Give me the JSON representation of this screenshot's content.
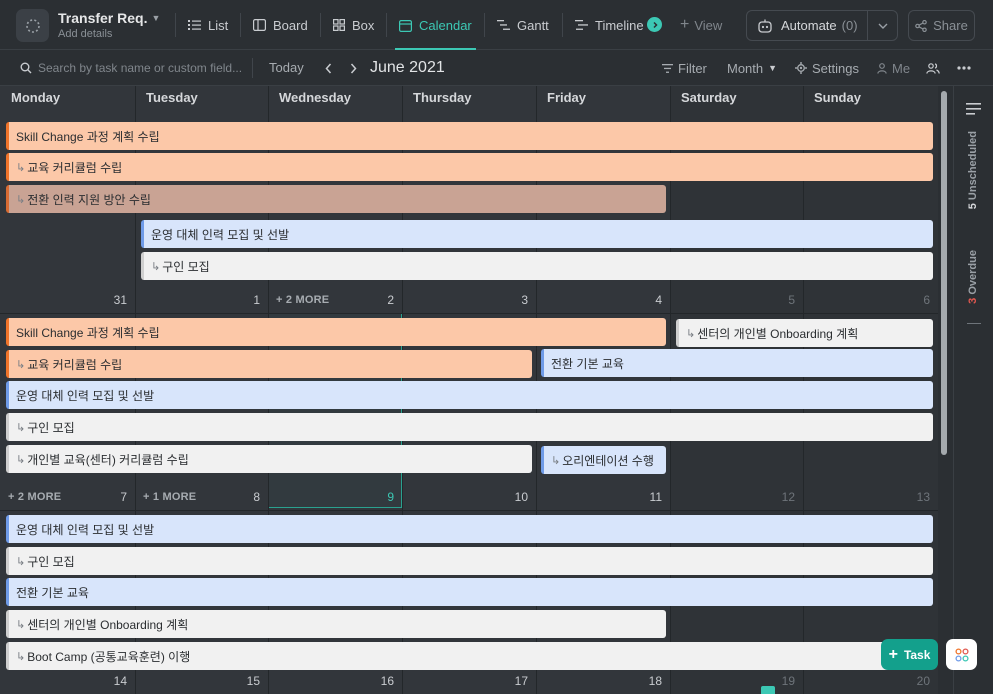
{
  "header": {
    "title": "Transfer Req.",
    "subtitle": "Add details",
    "views": [
      {
        "label": "List",
        "icon": "list-icon"
      },
      {
        "label": "Board",
        "icon": "board-icon"
      },
      {
        "label": "Box",
        "icon": "box-icon"
      },
      {
        "label": "Calendar",
        "icon": "calendar-icon",
        "active": true
      },
      {
        "label": "Gantt",
        "icon": "gantt-icon"
      },
      {
        "label": "Timeline",
        "icon": "timeline-icon"
      }
    ],
    "add_view_label": "View",
    "automate_label": "Automate",
    "automate_count": "(0)",
    "share_label": "Share"
  },
  "toolbar": {
    "search_placeholder": "Search by task name or custom field...",
    "today_label": "Today",
    "month_title": "June 2021",
    "filter_label": "Filter",
    "period_label": "Month",
    "settings_label": "Settings",
    "me_label": "Me"
  },
  "calendar": {
    "day_names": [
      "Monday",
      "Tuesday",
      "Wednesday",
      "Thursday",
      "Friday",
      "Saturday",
      "Sunday"
    ],
    "weeks": [
      {
        "days": [
          "31",
          "1",
          "2",
          "3",
          "4",
          "5",
          "6"
        ],
        "more": [
          {
            "day_index": 2,
            "label": "+ 2 MORE"
          }
        ],
        "tasks": [
          {
            "label": "Skill Change 과정 계획 수립",
            "color": "orange",
            "subtask": false
          },
          {
            "label": "교육 커리큘럼 수립",
            "color": "orange",
            "subtask": true
          },
          {
            "label": "전환 인력 지원 방안 수립",
            "color": "orange-dim",
            "subtask": true
          },
          {
            "label": "운영 대체 인력 모집 및 선발",
            "color": "blue",
            "subtask": false
          },
          {
            "label": "구인 모집",
            "color": "gray",
            "subtask": true
          }
        ]
      },
      {
        "days": [
          "7",
          "8",
          "9",
          "10",
          "11",
          "12",
          "13"
        ],
        "more": [
          {
            "day_index": 0,
            "label": "+ 2 MORE"
          },
          {
            "day_index": 1,
            "label": "+ 1 MORE"
          }
        ],
        "tasks": [
          {
            "label": "Skill Change 과정 계획 수립",
            "color": "orange",
            "subtask": false
          },
          {
            "label": "센터의 개인별 Onboarding 계획",
            "color": "gray",
            "subtask": true
          },
          {
            "label": "교육 커리큘럼 수립",
            "color": "orange",
            "subtask": true
          },
          {
            "label": "전환 기본 교육",
            "color": "blue",
            "subtask": false
          },
          {
            "label": "운영 대체 인력 모집 및 선발",
            "color": "blue",
            "subtask": false
          },
          {
            "label": "구인 모집",
            "color": "gray",
            "subtask": true
          },
          {
            "label": "개인별 교육(센터) 커리큘럼 수립",
            "color": "gray",
            "subtask": true
          },
          {
            "label": "오리엔테이션 수행",
            "color": "blue",
            "subtask": true
          }
        ]
      },
      {
        "days": [
          "14",
          "15",
          "16",
          "17",
          "18",
          "19",
          "20"
        ],
        "tasks": [
          {
            "label": "운영 대체 인력 모집 및 선발",
            "color": "blue",
            "subtask": false
          },
          {
            "label": "구인 모집",
            "color": "gray",
            "subtask": true
          },
          {
            "label": "전환 기본 교육",
            "color": "blue",
            "subtask": false
          },
          {
            "label": "센터의 개인별 Onboarding 계획",
            "color": "gray",
            "subtask": true
          },
          {
            "label": "Boot Camp (공통교육훈련) 이행",
            "color": "gray",
            "subtask": true
          }
        ]
      }
    ]
  },
  "sidebar": {
    "unscheduled_count": "5",
    "unscheduled_label": "Unscheduled",
    "overdue_count": "3",
    "overdue_label": "Overdue"
  },
  "fab": {
    "task_label": "Task"
  },
  "colors": {
    "accent": "#3cc8b4",
    "task_button": "#13a08c",
    "bar_orange": "#fcc8a8",
    "bar_blue": "#d8e5fb",
    "bar_gray": "#f1f1f1",
    "overdue": "#e0574f"
  }
}
